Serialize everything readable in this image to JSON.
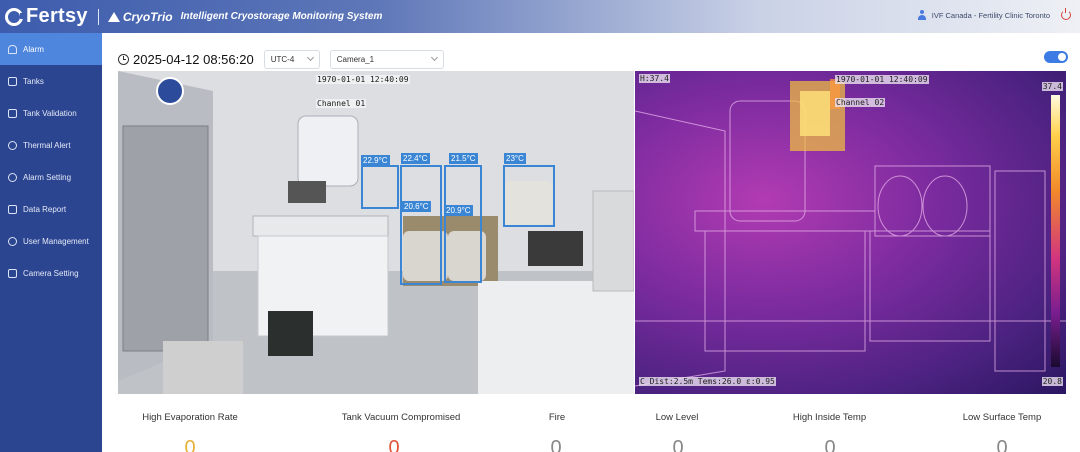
{
  "header": {
    "logo_text": "Fertsy",
    "brand2": "CryoTrio",
    "tagline": "Intelligent Cryostorage Monitoring System",
    "user": "IVF Canada - Fertility Clinic Toronto"
  },
  "sidebar": {
    "items": [
      {
        "label": "Alarm",
        "icon": "bell-icon",
        "active": true
      },
      {
        "label": "Tanks",
        "icon": "tank-icon"
      },
      {
        "label": "Tank Validation",
        "icon": "validation-icon"
      },
      {
        "label": "Thermal Alert",
        "icon": "thermal-icon"
      },
      {
        "label": "Alarm Setting",
        "icon": "alarm-setting-icon"
      },
      {
        "label": "Data Report",
        "icon": "report-icon"
      },
      {
        "label": "User Management",
        "icon": "user-icon"
      },
      {
        "label": "Camera Setting",
        "icon": "camera-icon"
      }
    ]
  },
  "toolbar": {
    "datetime": "2025-04-12 08:56:20",
    "timezone": "UTC-4",
    "camera": "Camera_1",
    "toggle_on": true
  },
  "rgb_camera": {
    "timestamp": "1970-01-01 12:40:09",
    "channel": "Channel 01",
    "temps": [
      "22.9°C",
      "22.4°C",
      "21.5°C",
      "23°C",
      "20.6°C",
      "20.9°C"
    ]
  },
  "thermal_camera": {
    "timestamp": "1970-01-01 12:40:09",
    "channel": "Channel 02",
    "h_value": "H:37.4",
    "scale_max": "37.4",
    "scale_min": "20.8",
    "info": "C Dist:2.5m    Tems:26.0    ε:0.95"
  },
  "alarms": [
    {
      "label": "High Evaporation Rate",
      "count": "0",
      "color": "#e6b23a"
    },
    {
      "label": "Tank Vacuum Compromised",
      "count": "0",
      "color": "#e0563a"
    },
    {
      "label": "Fire",
      "count": "0",
      "color": "#888888"
    },
    {
      "label": "Low Level",
      "count": "0",
      "color": "#888888"
    },
    {
      "label": "High Inside Temp",
      "count": "0",
      "color": "#888888"
    },
    {
      "label": "Low Surface Temp",
      "count": "0",
      "color": "#888888"
    }
  ]
}
